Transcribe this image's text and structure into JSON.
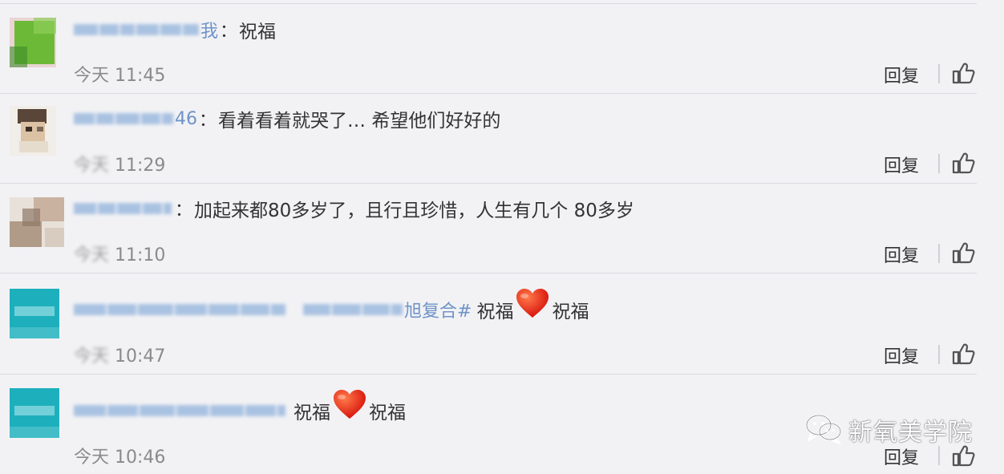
{
  "comments": [
    {
      "name_tail": "我",
      "colon": "：",
      "text": "祝福",
      "time_day": "今天",
      "time_clock": "11:45",
      "reply_label": "回复",
      "like_icon": "thumbs-up-icon",
      "avatar_colors": [
        "#6dbb3a",
        "#e9c8c8"
      ]
    },
    {
      "name_tail": "46",
      "colon": "：",
      "text": "看着看着就哭了… 希望他们好好的",
      "time_day": "今天",
      "time_clock": "11:29",
      "reply_label": "回复",
      "like_icon": "thumbs-up-icon",
      "avatar_colors": [
        "#4a3a30",
        "#d9c3a8"
      ]
    },
    {
      "name_tail": "",
      "colon": "：",
      "text": "加起来都80多岁了，且行且珍惜，人生有几个 80多岁",
      "time_day": "今天",
      "time_clock": "11:10",
      "reply_label": "回复",
      "like_icon": "thumbs-up-icon",
      "avatar_colors": [
        "#b9a28e",
        "#e4dad0"
      ]
    },
    {
      "name_tail": "旭复合#",
      "colon": "",
      "text_before": "祝福",
      "text_after": "祝福",
      "heart_icon": "red-heart-icon",
      "time_day": "今天",
      "time_clock": "10:47",
      "reply_label": "回复",
      "like_icon": "thumbs-up-icon",
      "avatar_colors": [
        "#1fb1bd",
        "#7ad2d8"
      ]
    },
    {
      "name_tail": "",
      "colon": "",
      "text_before": "祝福",
      "text_after": "祝福",
      "heart_icon": "red-heart-icon",
      "time_day": "今天",
      "time_clock": "10:46",
      "reply_label": "回复",
      "like_icon": "thumbs-up-icon",
      "avatar_colors": [
        "#1fb1bd",
        "#7ad2d8"
      ]
    }
  ],
  "watermark": {
    "icon": "wechat-icon",
    "text": "新氧美学院"
  },
  "colors": {
    "background": "#f2f2f5",
    "name_link": "#6f93c8",
    "heart": "#e8271c"
  }
}
